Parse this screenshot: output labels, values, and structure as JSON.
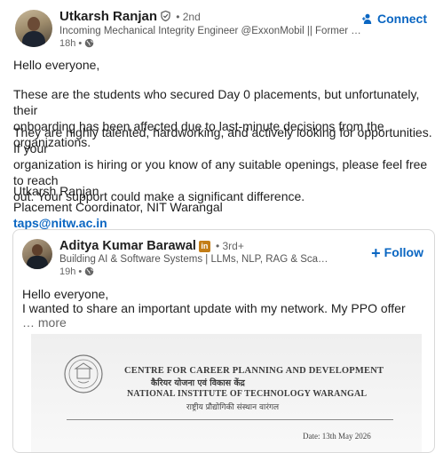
{
  "author": {
    "name": "Utkarsh Ranjan",
    "degree": "• 2nd",
    "headline": "Incoming Mechanical Integrity Engineer @ExxonMobil || Former Placement Coordinator",
    "time": "18h •",
    "connect_label": "Connect"
  },
  "post": {
    "greeting": "Hello everyone,",
    "p2_lines": [
      "These are the students who secured Day 0 placements, but unfortunately, their",
      "onboarding has been affected due to last-minute decisions from the organizations."
    ],
    "p3_lines": [
      "They are highly talented, hardworking, and actively looking for opportunities. If your",
      "organization is hiring or you know of any suitable openings, please feel free to reach",
      "out. Your support could make a significant difference."
    ],
    "signature_name": "Utkarsh Ranjan",
    "signature_title": "Placement Coordinator, NIT Warangal",
    "email": "taps@nitw.ac.in"
  },
  "shared": {
    "name": "Aditya Kumar Barawal",
    "badge": "in",
    "degree": "• 3rd+",
    "headline": "Building AI & Software Systems | LLMs, NLP, RAG & Scalable Backend Development",
    "time": "19h •",
    "follow_label": "Follow",
    "line1": "Hello everyone,",
    "line2": "I wanted to share an important update with my network. My PPO offer",
    "more": "… more",
    "document": {
      "line1": "CENTRE FOR CAREER PLANNING AND DEVELOPMENT",
      "line2": "कैरियर योजना एवं विकास केंद्र",
      "line3": "NATIONAL INSTITUTE OF TECHNOLOGY WARANGAL",
      "line4": "राष्ट्रीय प्रौद्योगिकी संस्थान वारंगल",
      "date": "Date: 13th May 2026"
    }
  },
  "colors": {
    "link": "#0a66c2",
    "badge": "#c37d16",
    "text": "#1f1f1f",
    "muted": "#666666"
  },
  "icons": {
    "verified": "shield-check-icon",
    "globe": "globe-icon",
    "connect": "add-person-icon",
    "follow": "plus-icon"
  }
}
